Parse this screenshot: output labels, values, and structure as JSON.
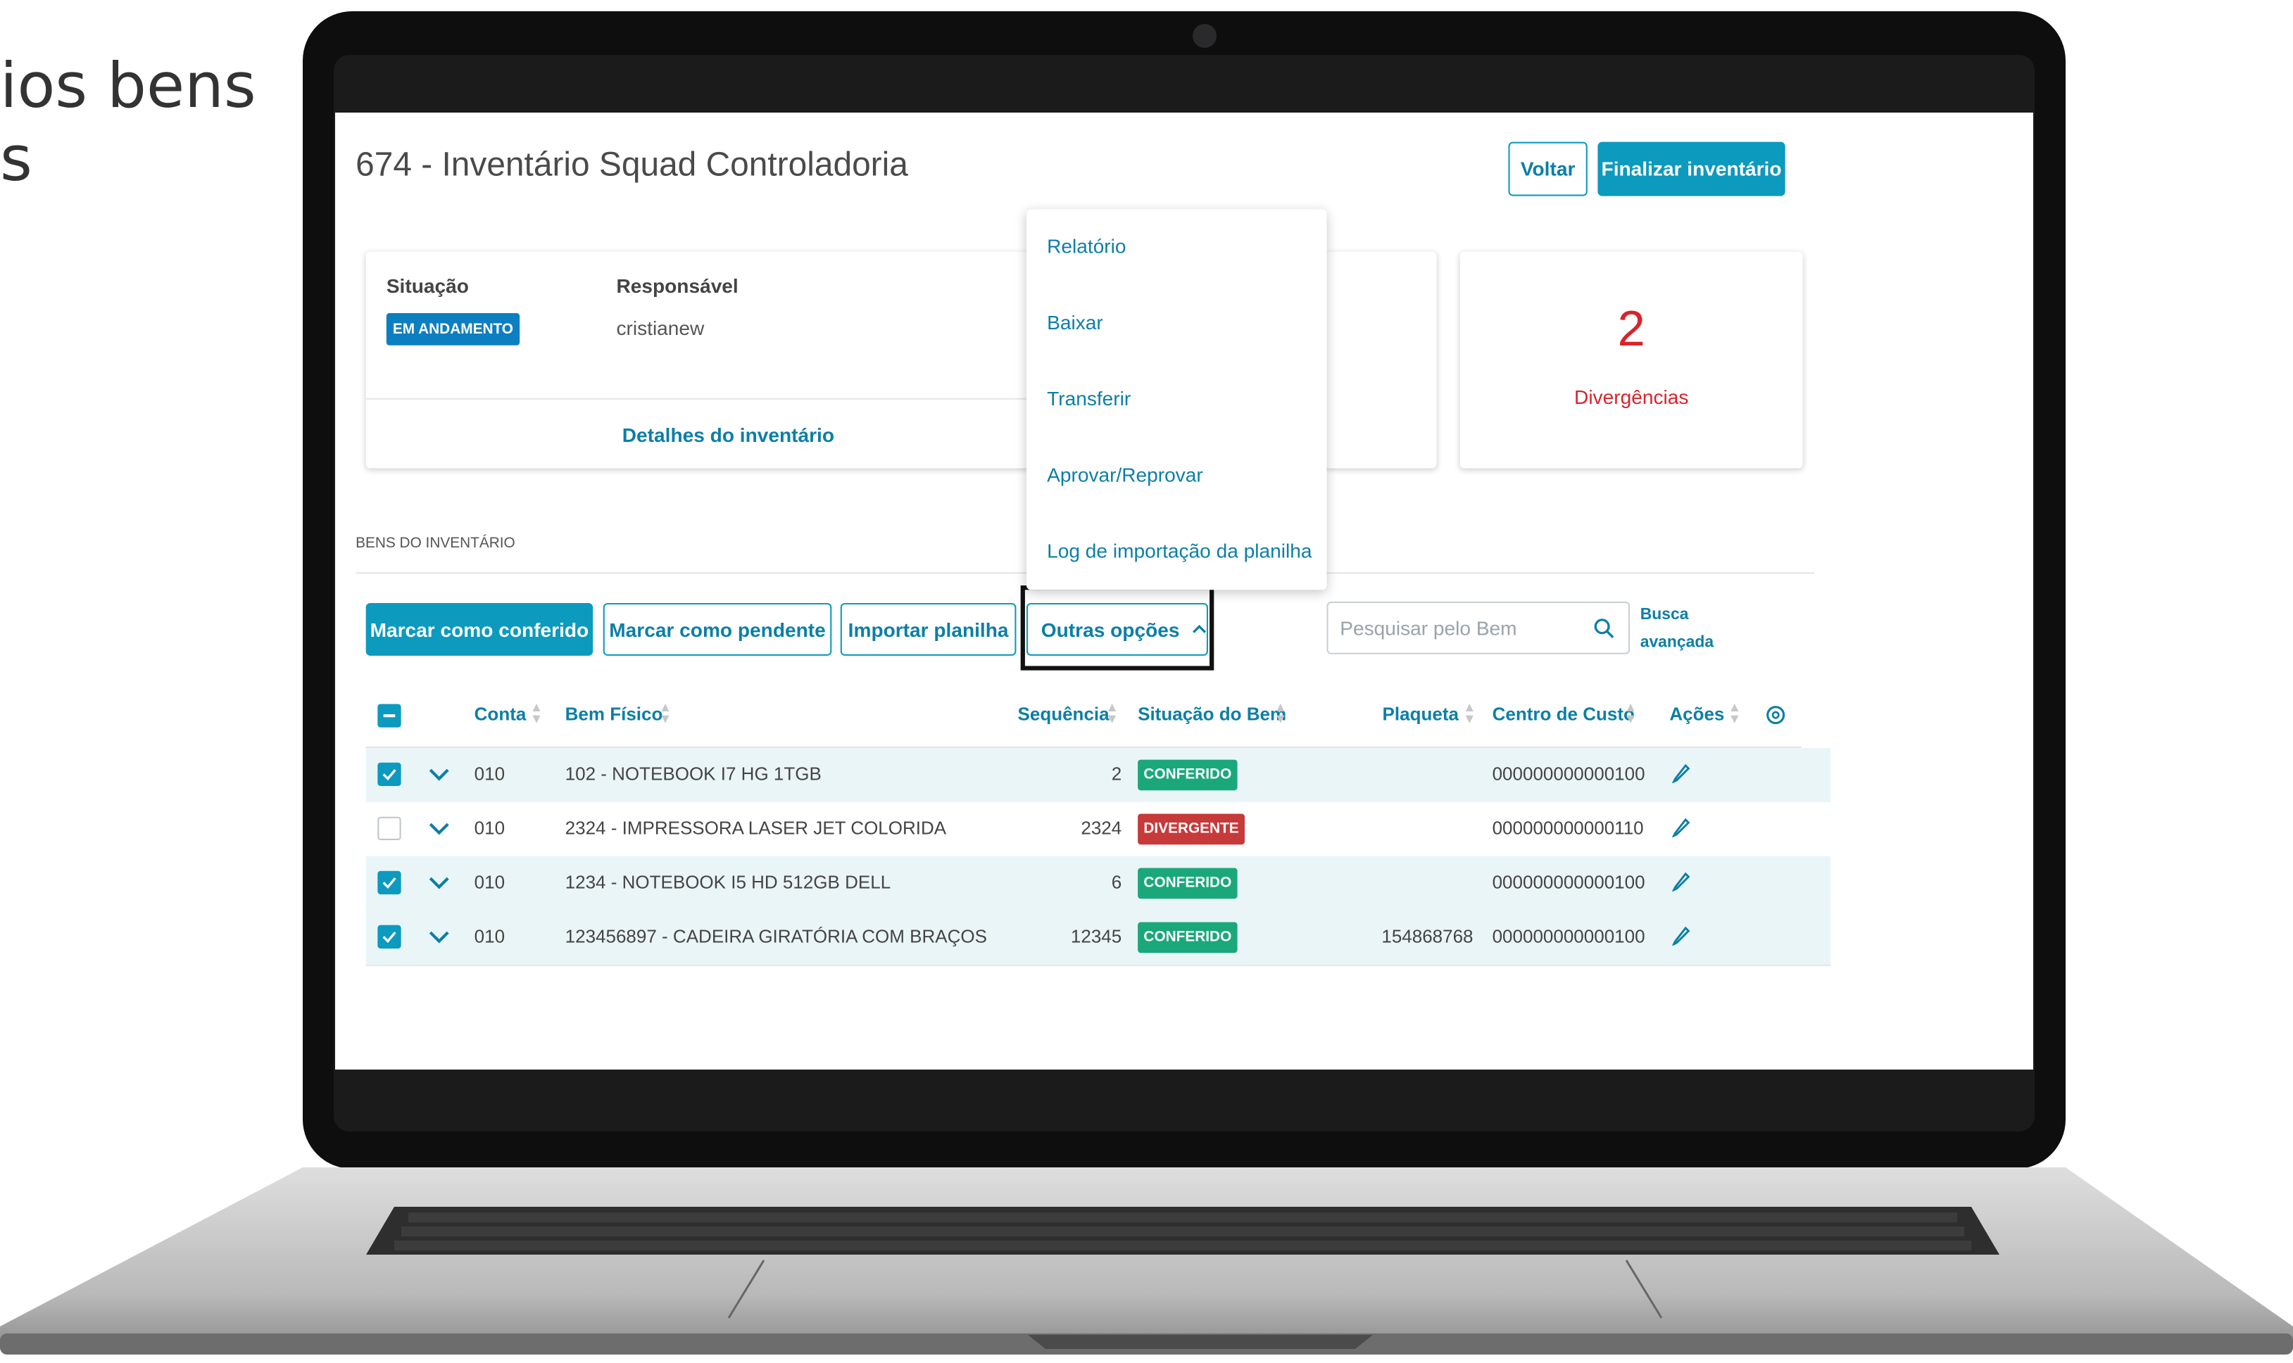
{
  "side_text": {
    "line1": "ios bens",
    "line2": "s"
  },
  "app": {
    "title": "674 - Inventário Squad Controladoria",
    "buttons": {
      "back": "Voltar",
      "finish": "Finalizar inventário"
    },
    "info_card": {
      "situacao_label": "Situação",
      "situacao_value": "EM ANDAMENTO",
      "responsavel_label": "Responsável",
      "responsavel_value": "cristianew",
      "details_link": "Detalhes do inventário"
    },
    "divergencias": {
      "count": "2",
      "label": "Divergências"
    },
    "menu_items": [
      "Relatório",
      "Baixar",
      "Transferir",
      "Aprovar/Reprovar",
      "Log de importação da planilha"
    ],
    "section_title": "BENS DO INVENTÁRIO",
    "toolbar": {
      "mark_done": "Marcar como conferido",
      "mark_pending": "Marcar como pendente",
      "import": "Importar planilha",
      "more": "Outras opções",
      "search_placeholder": "Pesquisar pelo Bem",
      "advanced1": "Busca",
      "advanced2": "avançada"
    },
    "columns": [
      "Conta",
      "Bem Físico",
      "Sequência",
      "Situação do Bem",
      "Plaqueta",
      "Centro de Custo",
      "Ações"
    ],
    "rows": [
      {
        "checked": true,
        "conta": "010",
        "bem": "102 - NOTEBOOK I7 HG 1TGB",
        "seq": "2",
        "situacao": "CONFERIDO",
        "plaqueta": "",
        "centro": "000000000000100"
      },
      {
        "checked": false,
        "conta": "010",
        "bem": "2324 - IMPRESSORA LASER JET COLORIDA",
        "seq": "2324",
        "situacao": "DIVERGENTE",
        "plaqueta": "",
        "centro": "000000000000110"
      },
      {
        "checked": true,
        "conta": "010",
        "bem": "1234 - NOTEBOOK I5 HD 512GB DELL",
        "seq": "6",
        "situacao": "CONFERIDO",
        "plaqueta": "",
        "centro": "000000000000100"
      },
      {
        "checked": true,
        "conta": "010",
        "bem": "123456897 - CADEIRA GIRATÓRIA COM BRAÇOS",
        "seq": "12345",
        "situacao": "CONFERIDO",
        "plaqueta": "154868768",
        "centro": "000000000000100"
      }
    ],
    "colors": {
      "accent": "#0c9abe",
      "conferido": "#1aa87a",
      "divergente": "#c63a3a",
      "divergencia_text": "#d9232b"
    }
  }
}
